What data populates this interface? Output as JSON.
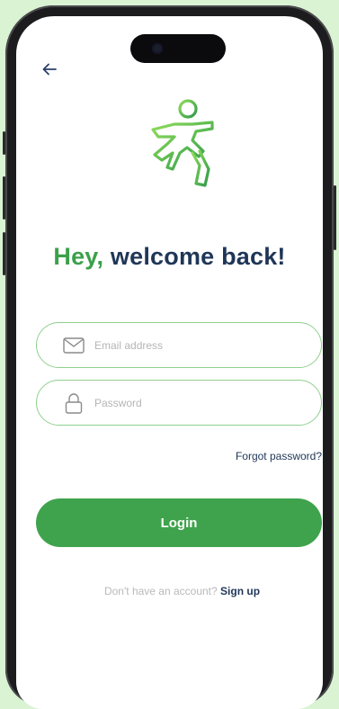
{
  "colors": {
    "background": "#d9f3d3",
    "brand_green": "#3fa34d",
    "navy": "#1f3657",
    "field_border": "#8fd08e"
  },
  "icons": {
    "back": "arrow-left-icon",
    "logo": "running-person-logo",
    "email": "envelope-icon",
    "password": "lock-icon"
  },
  "headline": {
    "part1": "Hey,",
    "part2": "welcome back!"
  },
  "form": {
    "email_placeholder": "Email address",
    "password_placeholder": "Password",
    "forgot_label": "Forgot password?",
    "login_label": "Login"
  },
  "signup": {
    "prompt": "Don't have an account?",
    "link": "Sign up"
  }
}
